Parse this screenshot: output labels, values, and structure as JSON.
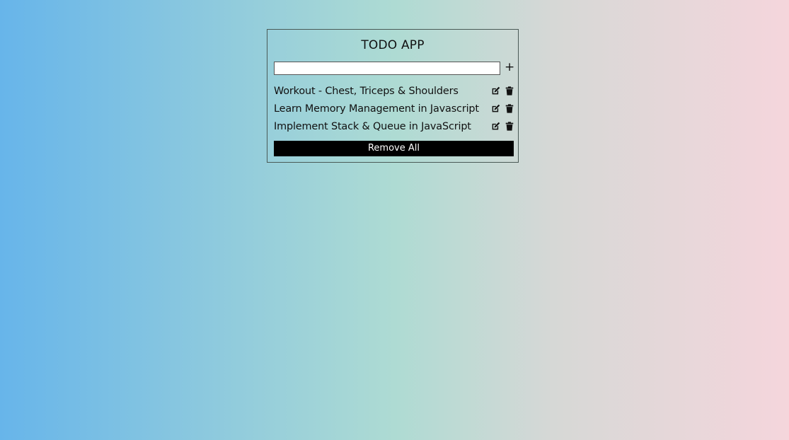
{
  "app": {
    "title": "TODO APP"
  },
  "new_todo": {
    "value": "",
    "placeholder": "",
    "add_label": "+"
  },
  "todos": [
    {
      "text": "Workout - Chest, Triceps & Shoulders",
      "edit_icon": "edit-icon",
      "delete_icon": "trash-icon"
    },
    {
      "text": "Learn Memory Management in Javascript",
      "edit_icon": "edit-icon",
      "delete_icon": "trash-icon"
    },
    {
      "text": "Implement Stack & Queue in JavaScript",
      "edit_icon": "edit-icon",
      "delete_icon": "trash-icon"
    }
  ],
  "actions": {
    "remove_all_label": "Remove All"
  },
  "colors": {
    "gradient_left": "#67b5ea",
    "gradient_mid": "#aedbd3",
    "gradient_right": "#f5d6dc",
    "button_bg": "#000000",
    "button_text": "#ffffff"
  }
}
